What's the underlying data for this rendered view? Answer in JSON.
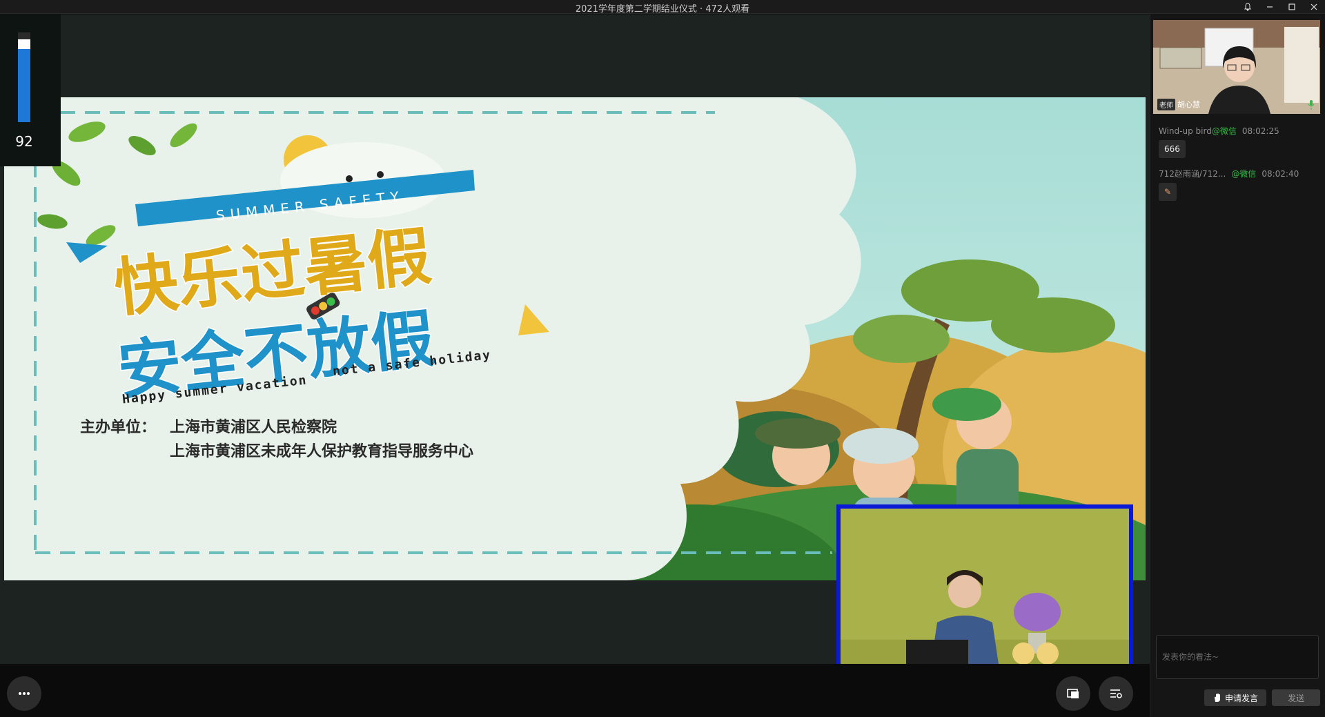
{
  "window": {
    "title": "2021学年度第二学期结业仪式 · 472人观看"
  },
  "volume": {
    "level": 92,
    "label": "92"
  },
  "slide": {
    "banner": "SUMMER SAFETY",
    "headline_line1": "快乐过暑假",
    "headline_line2": "安全不放假",
    "english_left": "Happy summer vacation",
    "english_right": "not a safe holiday",
    "organizer_label": "主办单位：",
    "organizer_1": "上海市黄浦区人民检察院",
    "organizer_2": "上海市黄浦区未成年人保护教育指导服务中心"
  },
  "sidebar": {
    "camera": {
      "badge": "老师",
      "name": "胡心慧"
    },
    "messages": [
      {
        "user": "Wind-up bird",
        "source": "@微信",
        "time": "08:02:25",
        "content": "666"
      },
      {
        "user": "712赵雨涵/712...",
        "source": "@微信",
        "time": "08:02:40",
        "content": "✎"
      }
    ],
    "comment_placeholder": "发表你的看法~",
    "raise_hand_label": "申请发言",
    "send_label": "发送"
  },
  "colors": {
    "inset_border": "#0a19d6",
    "volume_fill": "#1e78d8",
    "wechat_green": "#39b54a"
  }
}
